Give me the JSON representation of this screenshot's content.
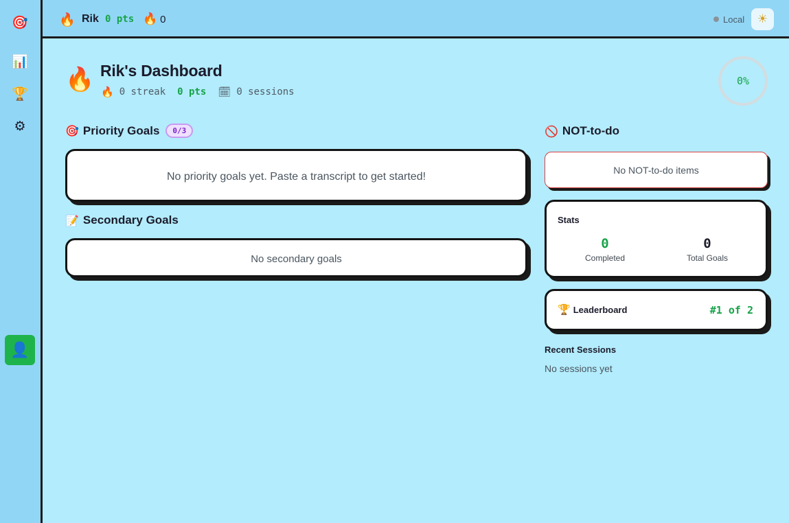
{
  "sidebar": {
    "items": [
      {
        "icon": "target-icon",
        "glyph": "🎯"
      },
      {
        "icon": "bar-chart-icon",
        "glyph": "📊"
      },
      {
        "icon": "trophy-icon",
        "glyph": "🏆"
      },
      {
        "icon": "gear-icon",
        "glyph": "⚙"
      }
    ],
    "user_glyph": "👤"
  },
  "topbar": {
    "fire_glyph": "🔥",
    "username": "Rik",
    "points": "0 pts",
    "streak_glyph": "🔥",
    "streak": "0",
    "mode": "Local",
    "theme_glyph": "☀"
  },
  "header": {
    "fire_glyph": "🔥",
    "title": "Rik's Dashboard",
    "streak_glyph": "🔥",
    "streak": "0 streak",
    "points": "0 pts",
    "sessions_glyph": "🗓",
    "sessions": "0 sessions",
    "progress_label": "0%",
    "progress_fraction": 0
  },
  "priority": {
    "glyph": "🎯",
    "title": "Priority Goals",
    "badge": "0/3",
    "empty": "No priority goals yet. Paste a transcript to get started!"
  },
  "secondary": {
    "glyph": "📝",
    "title": "Secondary Goals",
    "empty": "No secondary goals"
  },
  "not_todo": {
    "glyph": "🚫",
    "title": "NOT-to-do",
    "empty": "No NOT-to-do items"
  },
  "stats": {
    "title": "Stats",
    "completed_value": "0",
    "completed_label": "Completed",
    "total_value": "0",
    "total_label": "Total Goals"
  },
  "leaderboard": {
    "glyph": "🏆",
    "title": "Leaderboard",
    "rank": "#1 of 2"
  },
  "recent": {
    "title": "Recent Sessions",
    "empty": "No sessions yet"
  },
  "colors": {
    "background": "#b3ecfc",
    "panel": "#92d6f5",
    "accent_green": "#17a349",
    "user_button": "#1fb34c",
    "badge_purple": "#7a26c9"
  }
}
